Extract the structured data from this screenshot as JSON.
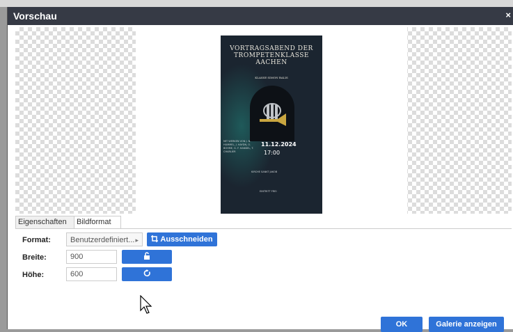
{
  "dialog": {
    "title": "Vorschau",
    "close_symbol": "×"
  },
  "poster": {
    "title": "VORTRAGSABEND DER TROMPETENKLASSE AACHEN",
    "subtitle": "KLASSE SIMON BALIS",
    "performers": "MIT WERKEN VON J. N. HUMMEL, J. HAYDN, O. BOHME, G. F. HANDEL, T. CHARLIER",
    "date": "11.12.2024",
    "time": "17:00",
    "venue": "KIRCHE SANKT JAKOB",
    "entry": "EINTRITT FREI",
    "colors": {
      "background": "#1b2530",
      "text": "#e9e6dc",
      "accent": "#c9a640"
    }
  },
  "tabs": [
    {
      "label": "Eigenschaften"
    },
    {
      "label": "Bildformat"
    }
  ],
  "form": {
    "format_label": "Format:",
    "format_value": "Benutzerdefiniert...",
    "format_arrow": "▸",
    "crop_button": "Ausschneiden",
    "width_label": "Breite:",
    "width_value": "900",
    "height_label": "Höhe:",
    "height_value": "600"
  },
  "buttons": {
    "ok": "OK",
    "gallery": "Galerie anzeigen"
  },
  "colors": {
    "titlebar": "#363a45",
    "primary": "#2f73d8"
  },
  "icons": {
    "crop": "crop-icon",
    "lock": "unlock-icon",
    "reset": "rotate-icon",
    "pointer": "mouse-pointer-icon"
  }
}
